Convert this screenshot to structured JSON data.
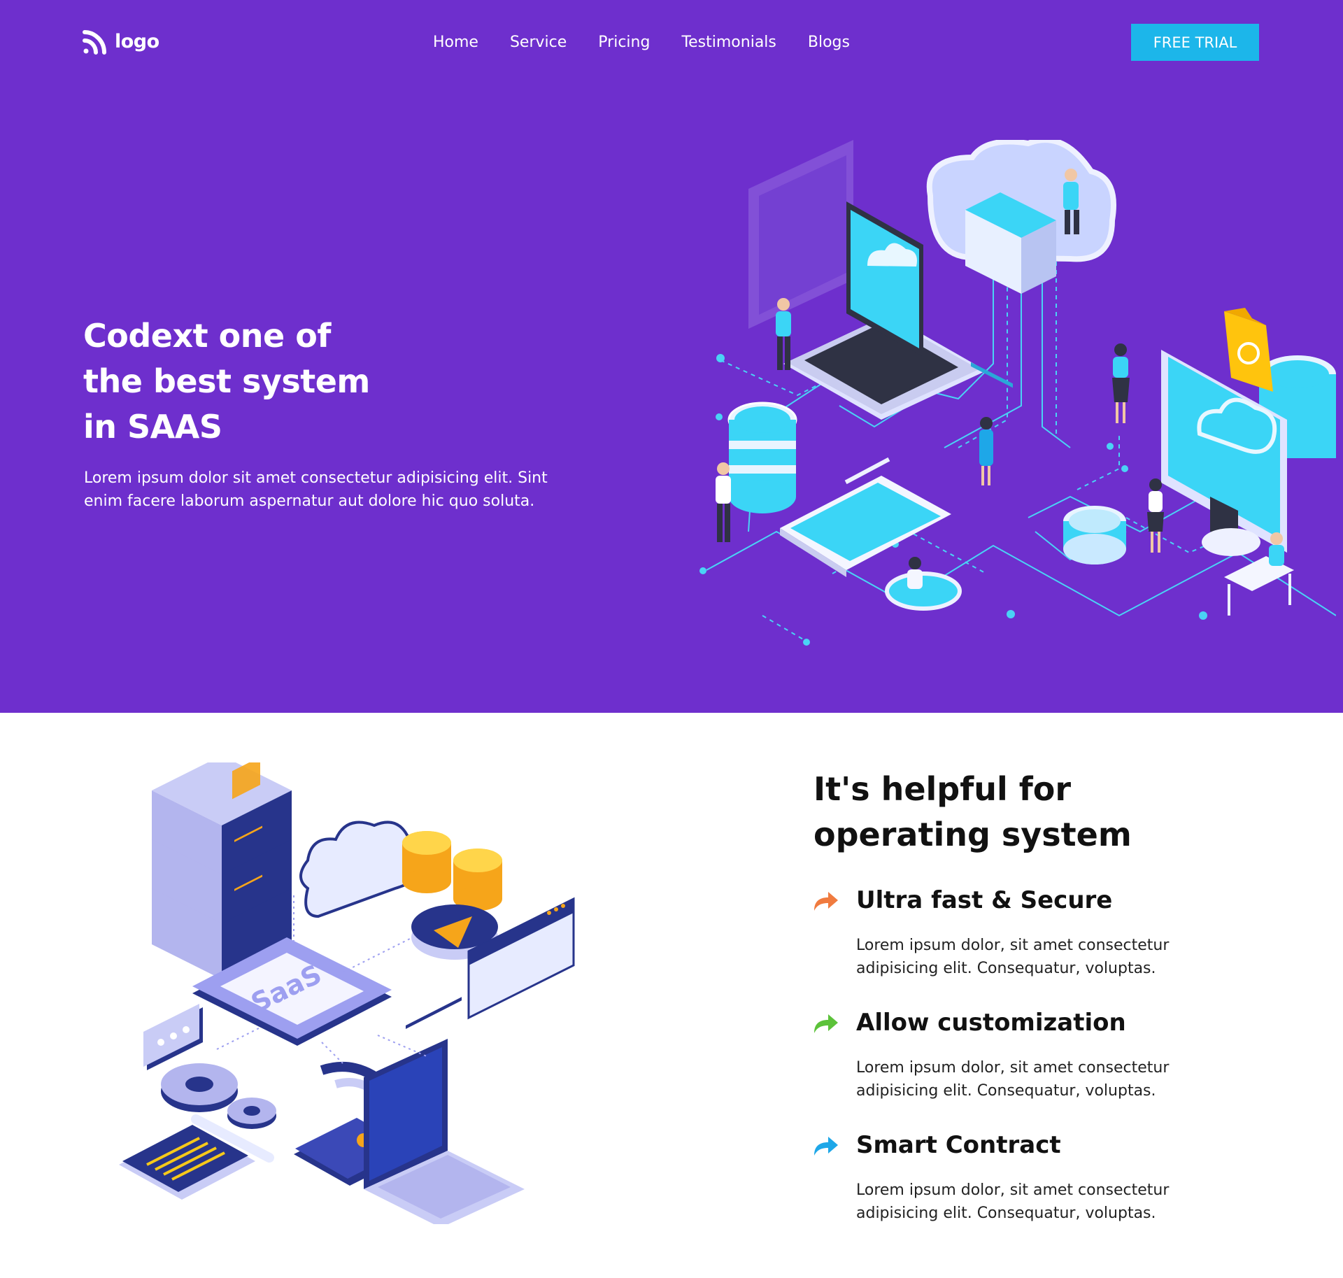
{
  "nav": {
    "logo_text": "logo",
    "links": [
      "Home",
      "Service",
      "Pricing",
      "Testimonials",
      "Blogs"
    ],
    "cta_label": "FREE TRIAL"
  },
  "hero": {
    "title_lines": [
      "Codext one of",
      "the best system",
      "in SAAS"
    ],
    "description": "Lorem ipsum dolor sit amet consectetur adipisicing elit. Sint enim facere laborum aspernatur aut dolore hic quo soluta."
  },
  "features": {
    "title": "It's helpful for operating system",
    "art_label": "SaaS",
    "items": [
      {
        "name": "Ultra fast & Secure",
        "description": "Lorem ipsum dolor, sit amet consectetur adipisicing elit. Consequatur, voluptas.",
        "icon": "share-arrow-icon",
        "icon_color": "#f07b3f"
      },
      {
        "name": "Allow customization",
        "description": "Lorem ipsum dolor, sit amet consectetur adipisicing elit. Consequatur, voluptas.",
        "icon": "share-arrow-icon",
        "icon_color": "#5cc23a"
      },
      {
        "name": "Smart Contract",
        "description": "Lorem ipsum dolor, sit amet consectetur adipisicing elit. Consequatur, voluptas.",
        "icon": "share-arrow-icon",
        "icon_color": "#1ea7e8"
      }
    ]
  },
  "colors": {
    "hero_bg": "#6e2fcd",
    "accent": "#1cb6ea",
    "text_dark": "#111111"
  }
}
